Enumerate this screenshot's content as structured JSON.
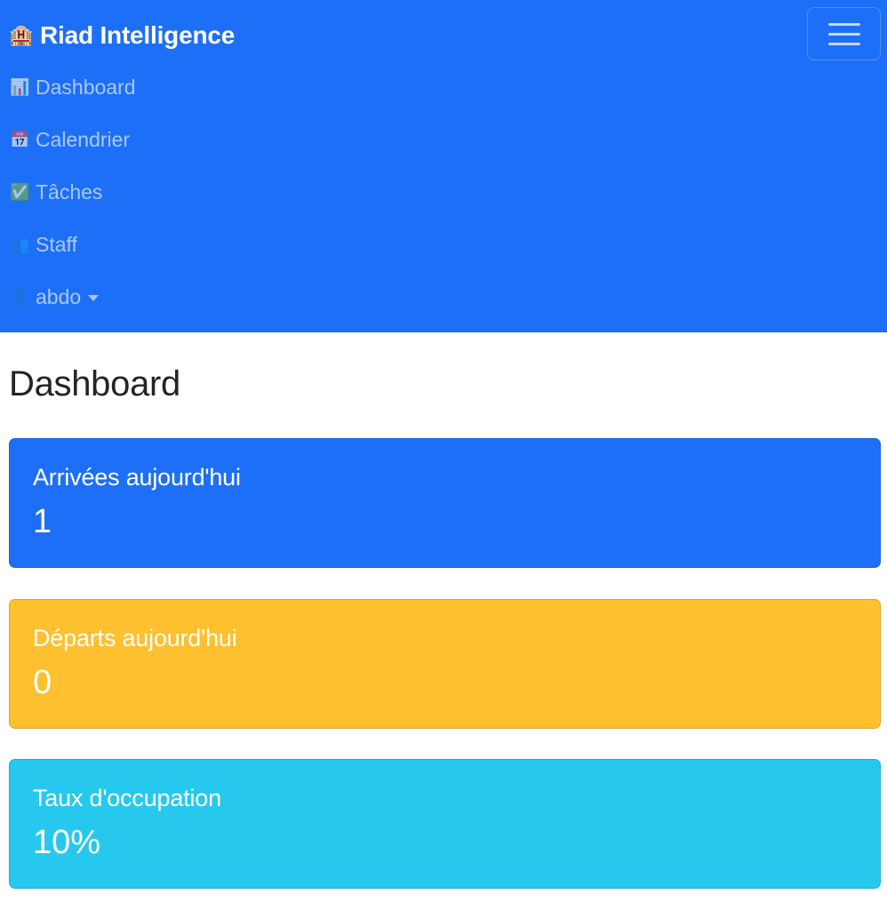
{
  "colors": {
    "navbar_bg": "#1d6ff7",
    "card_primary": "#1d6ff7",
    "card_warning": "#fec02f",
    "card_info": "#26c9ed"
  },
  "navbar": {
    "brand_icon": "hotel-icon",
    "brand_emoji": "🏨",
    "brand_text": "Riad Intelligence",
    "toggler_icon": "hamburger-menu-icon",
    "items": [
      {
        "icon": "bar-chart-icon",
        "emoji": "📊",
        "label": "Dashboard"
      },
      {
        "icon": "calendar-icon",
        "emoji": "📅",
        "label": "Calendrier"
      },
      {
        "icon": "check-box-icon",
        "emoji": "✅",
        "label": "Tâches"
      },
      {
        "icon": "people-icon",
        "emoji": "👥",
        "label": "Staff"
      },
      {
        "icon": "user-icon",
        "emoji": "👤",
        "label": "abdo"
      }
    ]
  },
  "page": {
    "title": "Dashboard"
  },
  "cards": [
    {
      "label": "Arrivées aujourd'hui",
      "value": "1"
    },
    {
      "label": "Départs aujourd'hui",
      "value": "0"
    },
    {
      "label": "Taux d'occupation",
      "value": "10%"
    }
  ]
}
